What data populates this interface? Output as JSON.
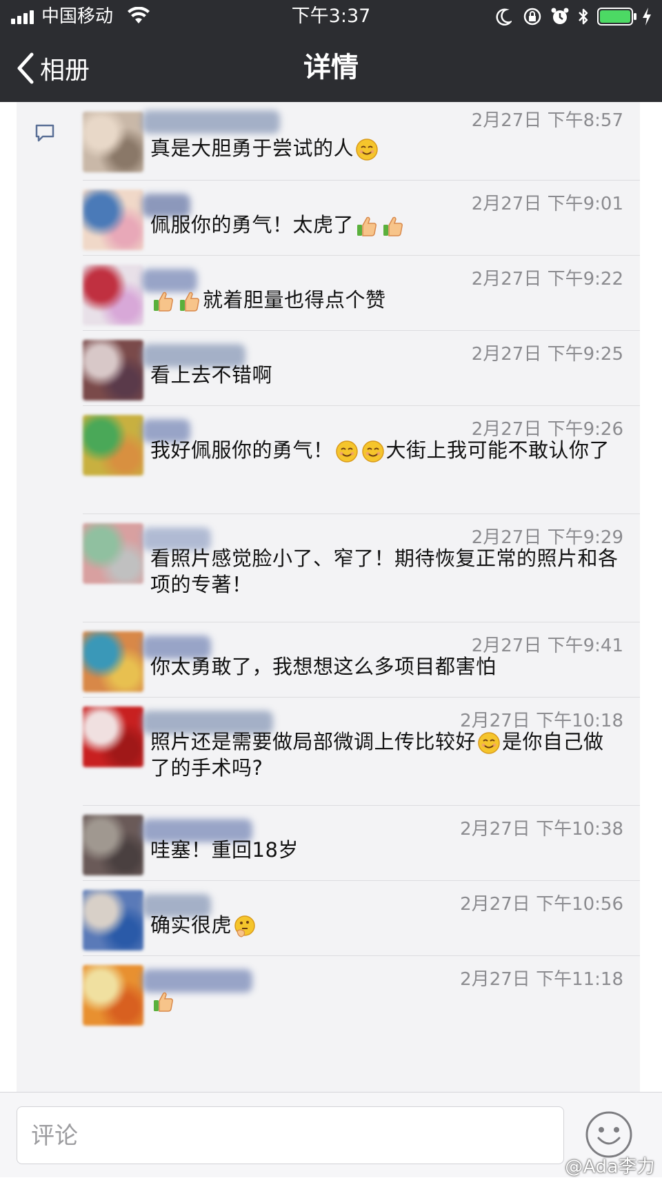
{
  "status_bar": {
    "carrier": "中国移动",
    "time": "下午3:37",
    "battery_color": "#4cd964"
  },
  "nav": {
    "back_label": "相册",
    "title": "详情"
  },
  "comments": [
    {
      "time": "2月27日 下午8:57",
      "parts": [
        {
          "t": "真是大胆勇于尝试的人"
        },
        {
          "e": "blush"
        }
      ],
      "avatar": [
        "#c9b8a8",
        "#e8d8c8",
        "#8a7868"
      ],
      "name_color": "#8a9ab8"
    },
    {
      "time": "2月27日 下午9:01",
      "parts": [
        {
          "t": "佩服你的勇气！太虎了"
        },
        {
          "e": "thumbs"
        },
        {
          "e": "thumbs"
        }
      ],
      "avatar": [
        "#f0d8c8",
        "#4a7ab8",
        "#e8a8b8"
      ],
      "name_color": "#6a7aa8"
    },
    {
      "time": "2月27日 下午9:22",
      "parts": [
        {
          "e": "thumbs"
        },
        {
          "e": "thumbs"
        },
        {
          "t": "就着胆量也得点个赞"
        }
      ],
      "avatar": [
        "#e8e0e8",
        "#c03040",
        "#d8a8d8"
      ],
      "name_color": "#7a8ab8"
    },
    {
      "time": "2月27日 下午9:25",
      "parts": [
        {
          "t": "看上去不错啊"
        }
      ],
      "avatar": [
        "#7a4a4a",
        "#d8c8c8",
        "#5a3a4a"
      ],
      "name_color": "#8a9ab8"
    },
    {
      "time": "2月27日 下午9:26",
      "parts": [
        {
          "t": "我好佩服你的勇气！"
        },
        {
          "e": "blush"
        },
        {
          "e": "blush"
        },
        {
          "t": "大街上我可能不敢认你了"
        }
      ],
      "avatar": [
        "#c8b040",
        "#4aa858",
        "#d89040"
      ],
      "name_color": "#7a8ab8"
    },
    {
      "time": "2月27日 下午9:29",
      "parts": [
        {
          "t": "看照片感觉脸小了、窄了！期待恢复正常的照片和各项的专著！"
        }
      ],
      "avatar": [
        "#d8a0a0",
        "#90c0a0",
        "#c0c0c0"
      ],
      "name_color": "#9aa8c8"
    },
    {
      "time": "2月27日 下午9:41",
      "parts": [
        {
          "t": "你太勇敢了，我想想这么多项目都害怕"
        }
      ],
      "avatar": [
        "#d88848",
        "#3a98b8",
        "#e8c050"
      ],
      "name_color": "#7a8ab8"
    },
    {
      "time": "2月27日 下午10:18",
      "parts": [
        {
          "t": "照片还是需要做局部微调上传比较好"
        },
        {
          "e": "blush"
        },
        {
          "t": "是你自己做了的手术吗?"
        }
      ],
      "avatar": [
        "#c82020",
        "#f0e0e0",
        "#a01818"
      ],
      "name_color": "#8a9ab8"
    },
    {
      "time": "2月27日 下午10:38",
      "parts": [
        {
          "t": "哇塞！重回18岁"
        }
      ],
      "avatar": [
        "#6a5a58",
        "#a09890",
        "#4a4040"
      ],
      "name_color": "#7a8ab8"
    },
    {
      "time": "2月27日 下午10:56",
      "parts": [
        {
          "t": "确实很虎"
        },
        {
          "e": "think"
        }
      ],
      "avatar": [
        "#5a7ab8",
        "#d8d0c8",
        "#2a5aa8"
      ],
      "name_color": "#8a9ab8"
    },
    {
      "time": "2月27日 下午11:18",
      "parts": [
        {
          "e": "thumbs"
        }
      ],
      "avatar": [
        "#e89030",
        "#f0e0a0",
        "#d86020"
      ],
      "name_color": "#7a8ab8"
    }
  ],
  "comment_input": {
    "placeholder": "评论"
  },
  "watermark": "@Ada李力"
}
